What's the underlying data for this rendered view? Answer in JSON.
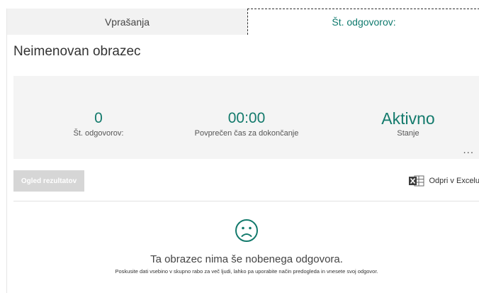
{
  "tabs": {
    "questions_label": "Vprašanja",
    "responses_label": "Št. odgovorov:"
  },
  "form": {
    "title": "Neimenovan obrazec"
  },
  "stats": {
    "responses_value": "0",
    "responses_label": "Št. odgovorov:",
    "avg_time_value": "00:00",
    "avg_time_label": "Povprečen čas za dokončanje",
    "status_value": "Aktivno",
    "status_label": "Stanje",
    "more_label": "..."
  },
  "toolbar": {
    "view_results_label": "Ogled rezultatov",
    "open_excel_label": "Odpri v Excelu",
    "excel_icon": "excel-icon"
  },
  "empty_state": {
    "icon": "sad-face-icon",
    "title": "Ta obrazec nima še nobenega odgovora.",
    "hint": "Poskusite dati vsebino v skupno rabo za več ljudi, lahko pa uporabite način predogleda in vnesete svoj odgovor."
  },
  "colors": {
    "accent": "#137a6c",
    "excel_green": "#1e7145"
  }
}
